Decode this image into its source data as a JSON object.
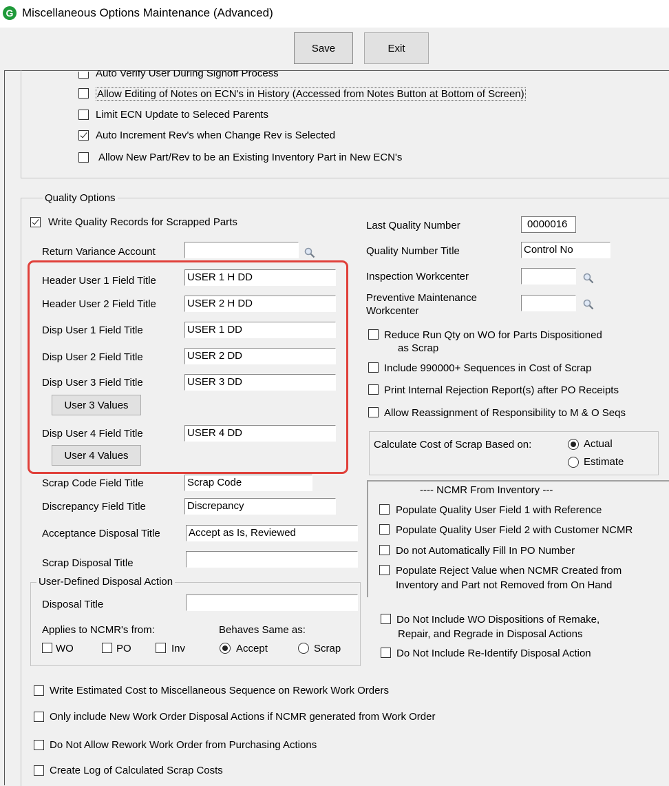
{
  "window": {
    "title": "Miscellaneous Options Maintenance (Advanced)",
    "icon_letter": "G"
  },
  "toolbar": {
    "save_label": "Save",
    "exit_label": "Exit"
  },
  "top_options": [
    {
      "label": "Auto Verify User During Signoff Process",
      "checked": false
    },
    {
      "label": "Allow Editing of Notes on ECN's in History (Accessed from Notes Button at Bottom of Screen)",
      "checked": false
    },
    {
      "label": "Limit ECN Update to Seleced Parents",
      "checked": false
    },
    {
      "label": "Auto Increment Rev's when Change Rev is Selected",
      "checked": true
    },
    {
      "label": "Allow New Part/Rev to be an Existing Inventory Part in New ECN's",
      "checked": false
    }
  ],
  "quality": {
    "legend": "Quality Options",
    "write_records": {
      "label": "Write Quality Records for Scrapped Parts",
      "checked": true
    },
    "return_variance": {
      "label": "Return Variance Account",
      "value": ""
    },
    "header_user1": {
      "label": "Header User 1 Field Title",
      "value": "USER 1 H DD"
    },
    "header_user2": {
      "label": "Header User 2 Field Title",
      "value": "USER 2 H DD"
    },
    "disp_user1": {
      "label": "Disp User 1 Field Title",
      "value": "USER 1 DD"
    },
    "disp_user2": {
      "label": "Disp User 2 Field Title",
      "value": "USER 2 DD"
    },
    "disp_user3": {
      "label": "Disp User 3 Field Title",
      "value": "USER 3 DD",
      "button": "User 3 Values"
    },
    "disp_user4": {
      "label": "Disp User 4 Field Title",
      "value": "USER 4 DD",
      "button": "User 4 Values"
    },
    "scrap_code": {
      "label": "Scrap Code Field Title",
      "value": "Scrap Code"
    },
    "discrepancy": {
      "label": "Discrepancy Field Title",
      "value": "Discrepancy"
    },
    "acceptance": {
      "label": "Acceptance Disposal Title",
      "value": "Accept as Is, Reviewed"
    },
    "scrap_disposal": {
      "label": "Scrap Disposal Title",
      "value": ""
    },
    "user_defined": {
      "legend": "User-Defined Disposal Action",
      "disposal_title": {
        "label": "Disposal Title",
        "value": ""
      },
      "applies_label": "Applies to NCMR's from:",
      "applies": [
        {
          "label": "WO",
          "checked": false
        },
        {
          "label": "PO",
          "checked": false
        },
        {
          "label": "Inv",
          "checked": false
        }
      ],
      "behaves_label": "Behaves Same as:",
      "behaves": [
        {
          "label": "Accept",
          "checked": true
        },
        {
          "label": "Scrap",
          "checked": false
        }
      ]
    },
    "last_quality_number": {
      "label": "Last Quality Number",
      "value": "0000016"
    },
    "quality_number_title": {
      "label": "Quality Number Title",
      "value": "Control No"
    },
    "inspection_workcenter": {
      "label": "Inspection Workcenter",
      "value": ""
    },
    "pm_workcenter": {
      "label_line1": "Preventive Maintenance",
      "label_line2": "Workcenter",
      "value": ""
    },
    "right_checks": [
      {
        "label_line1": "Reduce Run Qty on WO for Parts Dispositioned",
        "label_line2": "as Scrap",
        "checked": false
      },
      {
        "label_line1": "Include 990000+ Sequences in Cost of Scrap",
        "checked": false
      },
      {
        "label_line1": "Print Internal Rejection Report(s) after PO Receipts",
        "checked": false
      },
      {
        "label_line1": "Allow Reassignment of Responsibility to M & O Seqs",
        "checked": false
      }
    ],
    "cost_of_scrap": {
      "label": "Calculate Cost of Scrap Based on:",
      "options": [
        {
          "label": "Actual",
          "checked": true
        },
        {
          "label": "Estimate",
          "checked": false
        }
      ]
    },
    "ncmr_inventory": {
      "legend": "---- NCMR From Inventory ---",
      "items": [
        {
          "label_line1": "Populate Quality User Field 1 with Reference",
          "checked": false
        },
        {
          "label_line1": "Populate Quality User Field 2 with Customer NCMR",
          "checked": false
        },
        {
          "label_line1": "Do not Automatically Fill In PO Number",
          "checked": false
        },
        {
          "label_line1": "Populate Reject Value when NCMR Created from",
          "label_line2": "Inventory and Part not Removed from On Hand",
          "checked": false
        }
      ]
    },
    "disposal_checks": [
      {
        "label_line1": "Do Not Include WO Dispositions of Remake,",
        "label_line2": "Repair, and Regrade in Disposal Actions",
        "checked": false
      },
      {
        "label_line1": "Do Not Include Re-Identify Disposal Action",
        "checked": false
      }
    ]
  },
  "bottom_options": [
    {
      "label": "Write Estimated Cost to Miscellaneous Sequence on Rework Work Orders",
      "checked": false
    },
    {
      "label": "Only include New Work Order Disposal Actions if NCMR generated from Work Order",
      "checked": false
    },
    {
      "label": "Do Not Allow Rework Work Order from Purchasing Actions",
      "checked": false
    },
    {
      "label": "Create Log of Calculated Scrap Costs",
      "checked": false
    }
  ]
}
